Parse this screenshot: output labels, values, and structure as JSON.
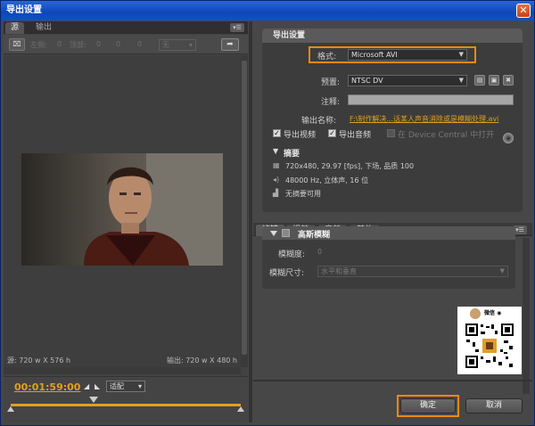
{
  "window": {
    "title": "导出设置",
    "close_glyph": "✕"
  },
  "left_panel": {
    "tabs": [
      "源",
      "输出"
    ],
    "menu_glyph": "▾☰",
    "crop": {
      "crop_button": "⌧",
      "left_label": "左侧:",
      "left_value": "0",
      "top_label": "顶部:",
      "top_value": "0",
      "right_value": "0",
      "bottom_value": "0",
      "zoom_value": "无"
    },
    "source_info": "源: 720 w X 576 h",
    "output_info": "输出: 720 w X 480 h",
    "timecode": "00:01:59:00",
    "fit_value": "适配"
  },
  "export_settings": {
    "header": "导出设置",
    "format_label": "格式:",
    "format_value": "Microsoft AVI",
    "preset_label": "预置:",
    "preset_value": "NTSC DV",
    "comment_label": "注释:",
    "output_name_label": "输出名称:",
    "output_name_value": "F:\\制作解决...话某人声音消除或是模糊处理.avi",
    "export_video_label": "导出视频",
    "export_video_checked": true,
    "export_audio_label": "导出音频",
    "export_audio_checked": true,
    "device_central_label": "在 Device Central 中打开",
    "device_central_checked": false,
    "summary_title": "摘要",
    "summary_video": "720x480, 29.97 [fps], 下场, 品质 100",
    "summary_audio": "48000 Hz, 立体声, 16 位",
    "summary_other": "无摘要可用"
  },
  "right_tabs": [
    "滤镜",
    "视频",
    "音频",
    "其他"
  ],
  "filter_panel": {
    "title": "高斯模糊",
    "blurriness_label": "模糊度:",
    "blurriness_value": "0",
    "dimension_label": "模糊尺寸:",
    "dimension_value": "水平和垂直"
  },
  "qr": {
    "name": "微信 ◉"
  },
  "buttons": {
    "ok": "确定",
    "cancel": "取消"
  },
  "colors": {
    "accent_orange": "#f08a10",
    "timecode": "#e0a020",
    "titlebar": "#0d48b8"
  },
  "icons": [
    "close-icon",
    "crop-icon",
    "rotate-icon",
    "save-preset-icon",
    "import-preset-icon",
    "delete-preset-icon",
    "info-icon",
    "film-icon",
    "audio-icon",
    "chart-icon"
  ]
}
